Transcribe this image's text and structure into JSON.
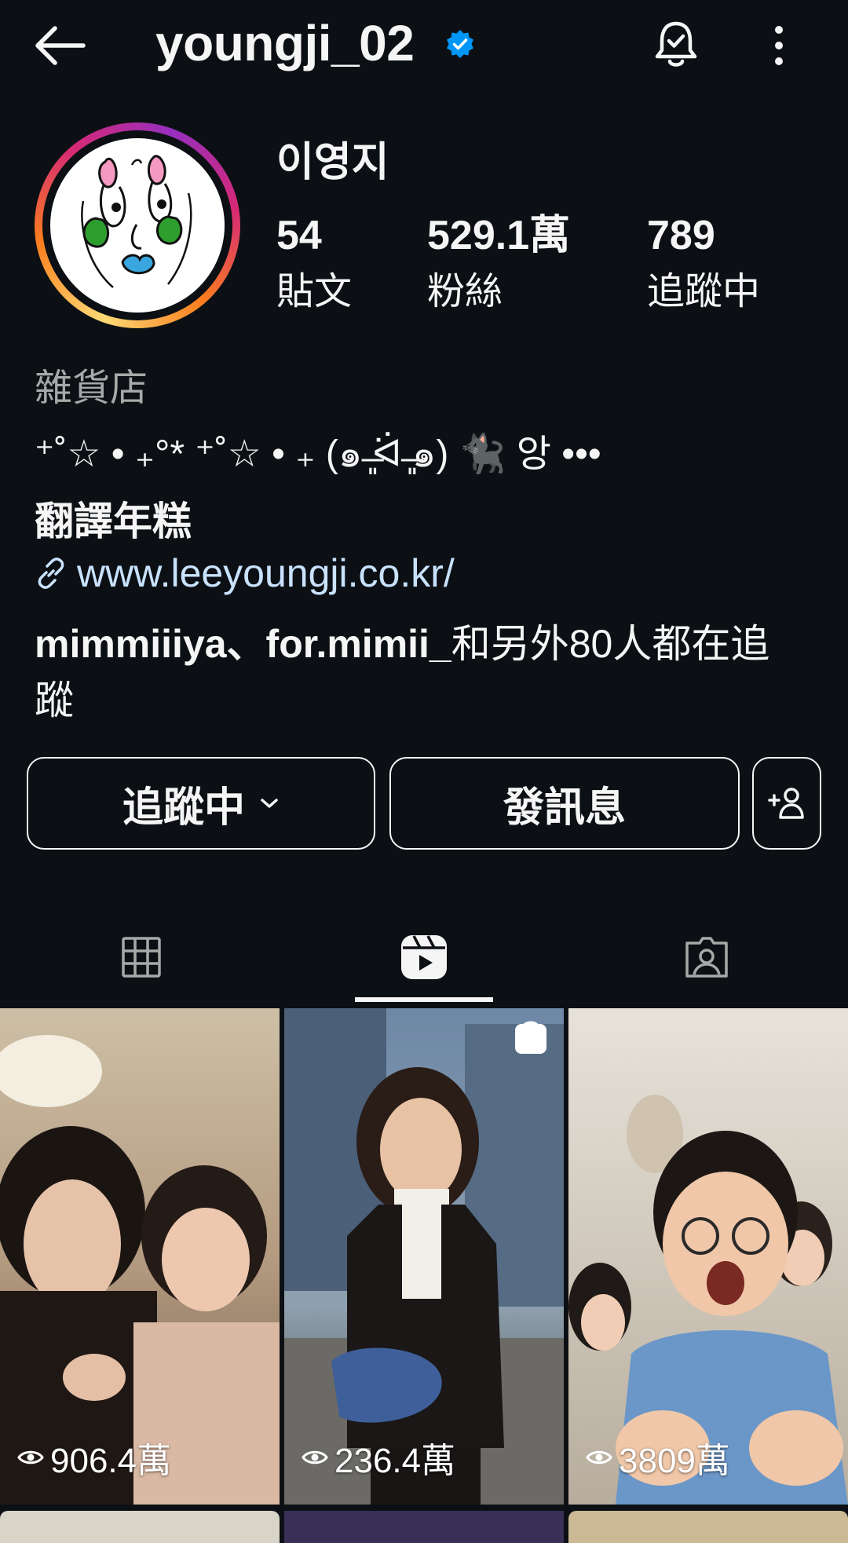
{
  "header": {
    "username": "youngji_02",
    "back_icon": "arrow-left-icon",
    "verified_icon": "verified-badge-icon",
    "bell_icon": "bell-check-icon",
    "more_icon": "more-vertical-icon",
    "accent_color": "#0095f6"
  },
  "profile": {
    "display_name": "이영지",
    "stats": [
      {
        "value": "54",
        "label": "貼文"
      },
      {
        "value": "529.1萬",
        "label": "粉絲"
      },
      {
        "value": "789",
        "label": "追蹤中"
      }
    ],
    "category": "雜貨店",
    "bio": "⁺˚☆ • ₊°* ⁺˚☆ • ₊ (๑ ̶̶͈ᐛ ̶̶͈๑) 🐈‍⬛ 앙 •••",
    "translate_label": "翻譯年糕",
    "link_icon": "link-icon",
    "link": "www.leeyoungji.co.kr/",
    "followed_by_names": "mimmiiiya、for.mimii_",
    "followed_by_rest": "和另外80人都在追蹤"
  },
  "actions": {
    "following_label": "追蹤中",
    "message_label": "發訊息",
    "suggest_icon": "add-person-icon"
  },
  "tabs": [
    {
      "name": "grid-icon",
      "active": false
    },
    {
      "name": "reels-icon",
      "active": true
    },
    {
      "name": "tagged-icon",
      "active": false
    }
  ],
  "reels": [
    {
      "views": "906.4萬",
      "shop": false
    },
    {
      "views": "236.4萬",
      "shop": true
    },
    {
      "views": "3809萬",
      "shop": false
    }
  ]
}
